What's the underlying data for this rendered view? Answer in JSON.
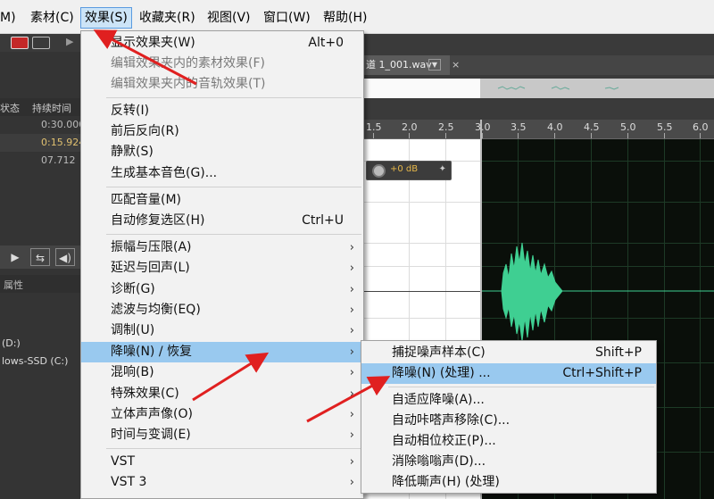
{
  "menubar": [
    {
      "label": "M)"
    },
    {
      "label": "素材(C)"
    },
    {
      "label": "效果(S)"
    },
    {
      "label": "收藏夹(R)"
    },
    {
      "label": "视图(V)"
    },
    {
      "label": "窗口(W)"
    },
    {
      "label": "帮助(H)"
    }
  ],
  "left_panel": {
    "col_status": "状态",
    "col_duration": "持续时间",
    "durations": [
      "0:30.000",
      "0:15.924",
      "07.712"
    ],
    "properties": "属性",
    "drives": [
      "(D:)",
      "lows-SSD (C:)"
    ]
  },
  "editor": {
    "tab_label": "道 1_001.wav",
    "tab_close": "×",
    "ruler_ticks": [
      "1.5",
      "2.0",
      "2.5",
      "3.0",
      "3.5",
      "4.0",
      "4.5",
      "5.0",
      "5.5",
      "6.0"
    ],
    "hud_value": "+0 dB",
    "toolbar_play": "▶"
  },
  "effects_menu": {
    "items": [
      {
        "label": "显示效果夹(W)",
        "shortcut": "Alt+0"
      },
      {
        "label": "编辑效果夹内的素材效果(F)",
        "disabled": true
      },
      {
        "label": "编辑效果夹内的音轨效果(T)",
        "disabled": true
      },
      {
        "label": "反转(I)"
      },
      {
        "label": "前后反向(R)"
      },
      {
        "label": "静默(S)"
      },
      {
        "label": "生成基本音色(G)..."
      },
      {
        "label": "匹配音量(M)"
      },
      {
        "label": "自动修复选区(H)",
        "shortcut": "Ctrl+U"
      },
      {
        "label": "振幅与压限(A)",
        "submenu": true
      },
      {
        "label": "延迟与回声(L)",
        "submenu": true
      },
      {
        "label": "诊断(G)",
        "submenu": true
      },
      {
        "label": "滤波与均衡(EQ)",
        "submenu": true
      },
      {
        "label": "调制(U)",
        "submenu": true
      },
      {
        "label": "降噪(N) / 恢复",
        "submenu": true,
        "highlighted": true
      },
      {
        "label": "混响(B)",
        "submenu": true
      },
      {
        "label": "特殊效果(C)",
        "submenu": true
      },
      {
        "label": "立体声声像(O)",
        "submenu": true
      },
      {
        "label": "时间与变调(E)",
        "submenu": true
      },
      {
        "label": "VST",
        "submenu": true
      },
      {
        "label": "VST 3",
        "submenu": true
      }
    ],
    "arrow_glyph": "›"
  },
  "noise_submenu": {
    "items": [
      {
        "label": "捕捉噪声样本(C)",
        "shortcut": "Shift+P"
      },
      {
        "label": "降噪(N)  (处理) ...",
        "shortcut": "Ctrl+Shift+P",
        "highlighted": true
      },
      {
        "label": "自适应降噪(A)..."
      },
      {
        "label": "自动咔嗒声移除(C)..."
      },
      {
        "label": "自动相位校正(P)..."
      },
      {
        "label": "消除嗡嗡声(D)..."
      },
      {
        "label": "降低嘶声(H)  (处理)"
      }
    ]
  },
  "colors": {
    "menu_highlight": "#99c9ef",
    "waveform": "#3fcf92",
    "annotation_arrow": "#e02020",
    "menubar_active": "#cce4f7"
  }
}
